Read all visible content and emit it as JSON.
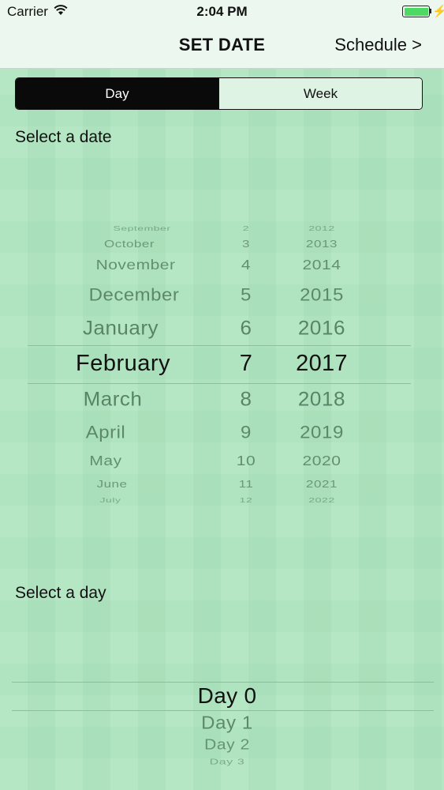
{
  "status_bar": {
    "carrier": "Carrier",
    "time": "2:04 PM"
  },
  "nav": {
    "title": "SET DATE",
    "right_button": "Schedule >"
  },
  "segmented": {
    "items": [
      "Day",
      "Week"
    ],
    "selected": "Day"
  },
  "labels": {
    "select_date": "Select a date",
    "select_day": "Select a day"
  },
  "date_picker": {
    "months": [
      "September",
      "October",
      "November",
      "December",
      "January",
      "February",
      "March",
      "April",
      "May",
      "June",
      "July"
    ],
    "days": [
      "2",
      "3",
      "4",
      "5",
      "6",
      "7",
      "8",
      "9",
      "10",
      "11",
      "12"
    ],
    "years": [
      "2012",
      "2013",
      "2014",
      "2015",
      "2016",
      "2017",
      "2018",
      "2019",
      "2020",
      "2021",
      "2022"
    ],
    "selected": {
      "month": "February",
      "day": "7",
      "year": "2017"
    }
  },
  "day_picker": {
    "items": [
      "Day 0",
      "Day 1",
      "Day 2",
      "Day 3"
    ],
    "selected": "Day 0"
  },
  "colors": {
    "background": "#aee5bf",
    "bar": "#ecf7ef",
    "segment_selected": "#0a0a0a",
    "battery": "#4cd964"
  }
}
